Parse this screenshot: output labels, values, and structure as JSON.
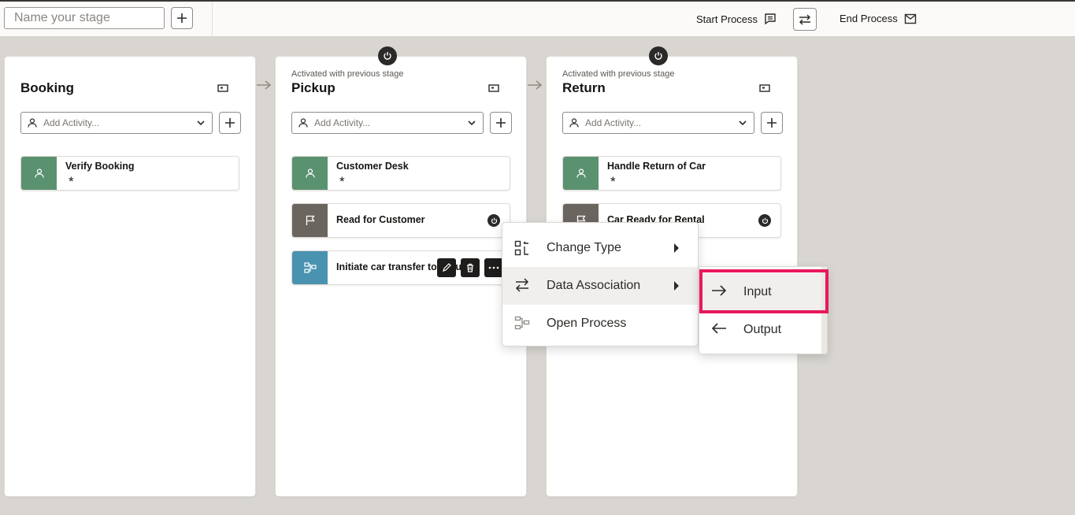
{
  "topbar": {
    "stage_name_placeholder": "Name your stage",
    "start_process": "Start Process",
    "end_process": "End Process"
  },
  "stages": [
    {
      "subtitle": "",
      "title": "Booking",
      "add_activity_placeholder": "Add Activity...",
      "activities": [
        {
          "name": "Verify Booking",
          "required_mark": "*"
        }
      ]
    },
    {
      "subtitle": "Activated with previous stage",
      "title": "Pickup",
      "add_activity_placeholder": "Add Activity...",
      "activities": [
        {
          "name": "Customer Desk",
          "required_mark": "*"
        },
        {
          "name": "Read for Customer"
        },
        {
          "name": "Initiate car transfer to Return"
        }
      ]
    },
    {
      "subtitle": "Activated with previous stage",
      "title": "Return",
      "add_activity_placeholder": "Add Activity...",
      "activities": [
        {
          "name": "Handle Return of Car",
          "required_mark": "*"
        },
        {
          "name": "Car Ready for Rental"
        }
      ]
    }
  ],
  "context_menu": {
    "items": [
      {
        "label": "Change Type",
        "icon": "change-type-icon"
      },
      {
        "label": "Data Association",
        "icon": "swap-icon"
      },
      {
        "label": "Open Process",
        "icon": "process-icon"
      }
    ]
  },
  "submenu": {
    "items": [
      {
        "label": "Input",
        "icon": "arrow-right-icon"
      },
      {
        "label": "Output",
        "icon": "arrow-left-icon"
      }
    ]
  },
  "colors": {
    "human_task": "#5a9270",
    "milestone": "#6b6560",
    "process": "#4a93b0",
    "highlight": "#e8185c"
  }
}
